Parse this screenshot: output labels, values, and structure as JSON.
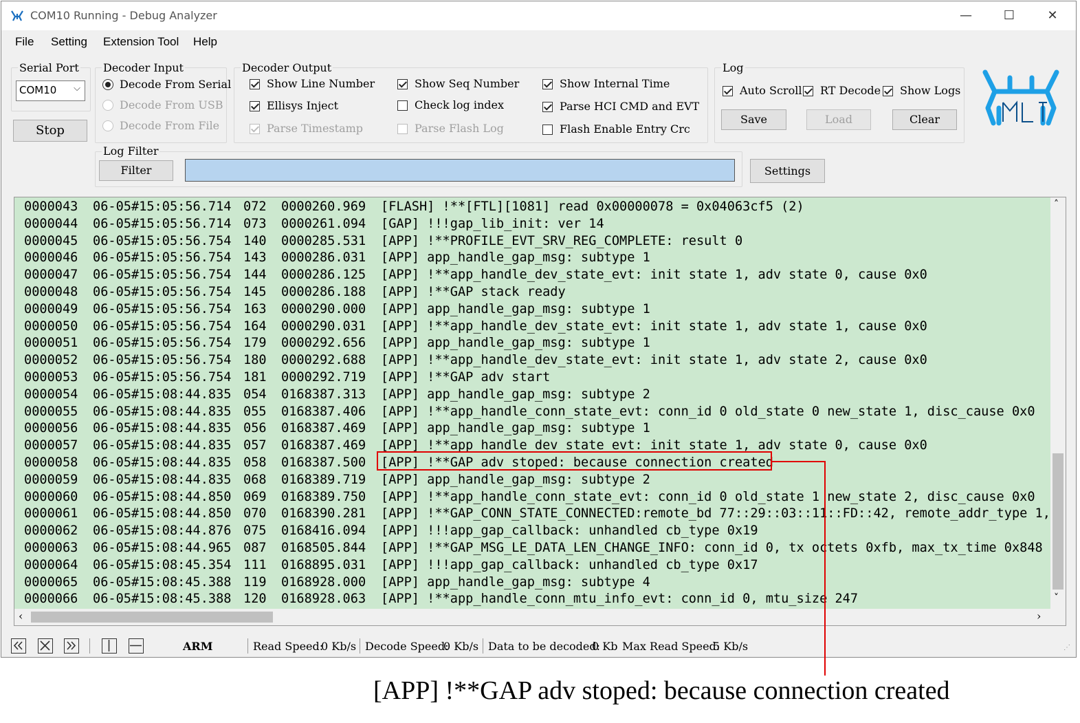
{
  "window": {
    "title": "COM10 Running - Debug Analyzer",
    "minimize_glyph": "—",
    "maximize_glyph": "☐",
    "close_glyph": "✕"
  },
  "menu": [
    "File",
    "Setting",
    "Extension Tool",
    "Help"
  ],
  "serial_port": {
    "label": "Serial Port",
    "value": "COM10",
    "stop_label": "Stop"
  },
  "decoder_input": {
    "label": "Decoder Input",
    "options": [
      {
        "label": "Decode From Serial",
        "selected": true,
        "enabled": true
      },
      {
        "label": "Decode From USB",
        "selected": false,
        "enabled": false
      },
      {
        "label": "Decode From File",
        "selected": false,
        "enabled": false
      }
    ]
  },
  "decoder_output": {
    "label": "Decoder Output",
    "options": [
      {
        "label": "Show Line Number",
        "checked": true,
        "enabled": true
      },
      {
        "label": "Ellisys Inject",
        "checked": true,
        "enabled": true
      },
      {
        "label": "Parse Timestamp",
        "checked": true,
        "enabled": false
      },
      {
        "label": "Show Seq Number",
        "checked": true,
        "enabled": true
      },
      {
        "label": "Check log index",
        "checked": false,
        "enabled": true
      },
      {
        "label": "Parse Flash Log",
        "checked": false,
        "enabled": false
      },
      {
        "label": "Show Internal Time",
        "checked": true,
        "enabled": true
      },
      {
        "label": "Parse HCI CMD and EVT",
        "checked": true,
        "enabled": true
      },
      {
        "label": "Flash Enable Entry Crc",
        "checked": false,
        "enabled": true
      }
    ]
  },
  "log_group": {
    "label": "Log",
    "options": [
      {
        "label": "Auto Scroll",
        "checked": true
      },
      {
        "label": "RT Decode",
        "checked": true
      },
      {
        "label": "Show Logs",
        "checked": true
      }
    ],
    "save_label": "Save",
    "load_label": "Load",
    "clear_label": "Clear"
  },
  "log_filter": {
    "label": "Log Filter",
    "filter_label": "Filter",
    "value": "",
    "settings_label": "Settings"
  },
  "log_rows": [
    [
      "0000043",
      "06-05#15:05:56.714",
      "072",
      "0000260.969",
      "[FLASH] !**[FTL][1081] read 0x00000078 = 0x04063cf5 (2)"
    ],
    [
      "0000044",
      "06-05#15:05:56.714",
      "073",
      "0000261.094",
      "[GAP] !!!gap_lib_init: ver 14"
    ],
    [
      "0000045",
      "06-05#15:05:56.754",
      "140",
      "0000285.531",
      "[APP] !**PROFILE_EVT_SRV_REG_COMPLETE: result 0"
    ],
    [
      "0000046",
      "06-05#15:05:56.754",
      "143",
      "0000286.031",
      "[APP] app_handle_gap_msg: subtype 1"
    ],
    [
      "0000047",
      "06-05#15:05:56.754",
      "144",
      "0000286.125",
      "[APP] !**app_handle_dev_state_evt: init state 1, adv state 0, cause 0x0"
    ],
    [
      "0000048",
      "06-05#15:05:56.754",
      "145",
      "0000286.188",
      "[APP] !**GAP stack ready"
    ],
    [
      "0000049",
      "06-05#15:05:56.754",
      "163",
      "0000290.000",
      "[APP] app_handle_gap_msg: subtype 1"
    ],
    [
      "0000050",
      "06-05#15:05:56.754",
      "164",
      "0000290.031",
      "[APP] !**app_handle_dev_state_evt: init state 1, adv state 1, cause 0x0"
    ],
    [
      "0000051",
      "06-05#15:05:56.754",
      "179",
      "0000292.656",
      "[APP] app_handle_gap_msg: subtype 1"
    ],
    [
      "0000052",
      "06-05#15:05:56.754",
      "180",
      "0000292.688",
      "[APP] !**app_handle_dev_state_evt: init state 1, adv state 2, cause 0x0"
    ],
    [
      "0000053",
      "06-05#15:05:56.754",
      "181",
      "0000292.719",
      "[APP] !**GAP adv start"
    ],
    [
      "0000054",
      "06-05#15:08:44.835",
      "054",
      "0168387.313",
      "[APP] app_handle_gap_msg: subtype 2"
    ],
    [
      "0000055",
      "06-05#15:08:44.835",
      "055",
      "0168387.406",
      "[APP] !**app_handle_conn_state_evt: conn_id 0 old_state 0 new_state 1, disc_cause 0x0"
    ],
    [
      "0000056",
      "06-05#15:08:44.835",
      "056",
      "0168387.469",
      "[APP] app_handle_gap_msg: subtype 1"
    ],
    [
      "0000057",
      "06-05#15:08:44.835",
      "057",
      "0168387.469",
      "[APP] !**app_handle_dev_state_evt: init state 1, adv state 0, cause 0x0"
    ],
    [
      "0000058",
      "06-05#15:08:44.835",
      "058",
      "0168387.500",
      "[APP] !**GAP adv stoped: because connection created"
    ],
    [
      "0000059",
      "06-05#15:08:44.835",
      "068",
      "0168389.719",
      "[APP] app_handle_gap_msg: subtype 2"
    ],
    [
      "0000060",
      "06-05#15:08:44.850",
      "069",
      "0168389.750",
      "[APP] !**app_handle_conn_state_evt: conn_id 0 old_state 1 new_state 2, disc_cause 0x0"
    ],
    [
      "0000061",
      "06-05#15:08:44.850",
      "070",
      "0168390.281",
      "[APP] !**GAP_CONN_STATE_CONNECTED:remote_bd 77::29::03::11::FD::42, remote_addr_type 1,"
    ],
    [
      "0000062",
      "06-05#15:08:44.876",
      "075",
      "0168416.094",
      "[APP] !!!app_gap_callback: unhandled cb_type 0x19"
    ],
    [
      "0000063",
      "06-05#15:08:44.965",
      "087",
      "0168505.844",
      "[APP] !**GAP_MSG_LE_DATA_LEN_CHANGE_INFO: conn_id 0, tx octets 0xfb, max_tx_time 0x848"
    ],
    [
      "0000064",
      "06-05#15:08:45.354",
      "111",
      "0168895.031",
      "[APP] !!!app_gap_callback: unhandled cb_type 0x17"
    ],
    [
      "0000065",
      "06-05#15:08:45.388",
      "119",
      "0168928.000",
      "[APP] app_handle_gap_msg: subtype 4"
    ],
    [
      "0000066",
      "06-05#15:08:45.388",
      "120",
      "0168928.063",
      "[APP] !**app_handle_conn_mtu_info_evt: conn_id 0, mtu_size 247"
    ]
  ],
  "highlighted_row_index": 15,
  "status": {
    "arch": "ARM",
    "read_speed_label": "Read Speed:",
    "read_speed": "0 Kb/s",
    "decode_speed_label": "Decode Speed:",
    "decode_speed": "0 Kb/s",
    "to_decode_label": "Data to be decoded:",
    "to_decode": "0 Kb",
    "max_read_label": "Max Read Speed:",
    "max_read": "5 Kb/s"
  },
  "callout_text": "[APP] !**GAP adv stoped: because connection created",
  "colors": {
    "log_bg": "#cce8cf",
    "highlight": "#e00000",
    "filter_bg": "#b7d4ef",
    "logo": "#1ea0e6"
  }
}
